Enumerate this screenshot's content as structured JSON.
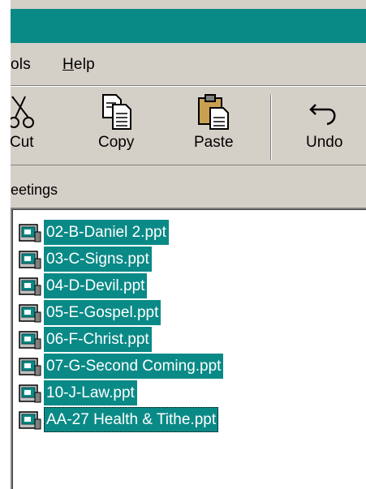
{
  "menubar": {
    "items": [
      {
        "label_pre": "",
        "label_ul": "",
        "label_post": "ols"
      },
      {
        "label_pre": "",
        "label_ul": "H",
        "label_post": "elp"
      }
    ]
  },
  "toolbar": {
    "buttons": [
      {
        "label": "Cut",
        "icon": "scissors-icon"
      },
      {
        "label": "Copy",
        "icon": "copy-icon"
      },
      {
        "label": "Paste",
        "icon": "clipboard-icon"
      },
      {
        "label": "Undo",
        "icon": "undo-arrow-icon"
      }
    ]
  },
  "address": {
    "text": "eetings"
  },
  "files": [
    {
      "name": "02-B-Daniel 2.ppt"
    },
    {
      "name": "03-C-Signs.ppt"
    },
    {
      "name": "04-D-Devil.ppt"
    },
    {
      "name": "05-E-Gospel.ppt"
    },
    {
      "name": "06-F-Christ.ppt"
    },
    {
      "name": "07-G-Second Coming.ppt"
    },
    {
      "name": "10-J-Law.ppt"
    },
    {
      "name": "AA-27 Health & Tithe.ppt"
    }
  ],
  "colors": {
    "selection": "#0a8a87",
    "titlebar": "#0a8a87",
    "window": "#d4d0c8"
  }
}
